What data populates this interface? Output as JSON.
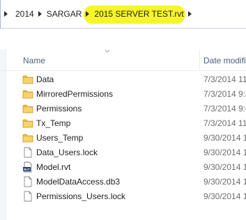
{
  "address_bar": {
    "crumbs": [
      "2014",
      "SARGAR",
      "2015 SERVER TEST.rvt"
    ],
    "highlight_color": "#f5f52a"
  },
  "columns": {
    "name": "Name",
    "date": "Date modifi"
  },
  "files": [
    {
      "name": "Data",
      "date": "7/3/2014 11",
      "icon": "folder-icon"
    },
    {
      "name": "MirroredPermissions",
      "date": "7/3/2014 9:4",
      "icon": "folder-icon"
    },
    {
      "name": "Permissions",
      "date": "7/3/2014 9:4",
      "icon": "folder-icon"
    },
    {
      "name": "Tx_Temp",
      "date": "7/3/2014 11",
      "icon": "folder-icon"
    },
    {
      "name": "Users_Temp",
      "date": "9/30/2014 1",
      "icon": "folder-icon"
    },
    {
      "name": "Data_Users.lock",
      "date": "9/30/2014 1",
      "icon": "file-icon"
    },
    {
      "name": "Model.rvt",
      "date": "9/30/2014 1",
      "icon": "rvt-file-icon"
    },
    {
      "name": "ModelDataAccess.db3",
      "date": "9/30/2014 1",
      "icon": "file-icon"
    },
    {
      "name": "Permissions_Users.lock",
      "date": "9/30/2014 1",
      "icon": "file-icon"
    }
  ],
  "rvt_badge": "RVT",
  "colors": {
    "folder": "#e8b83c",
    "header_text": "#4c607a"
  }
}
